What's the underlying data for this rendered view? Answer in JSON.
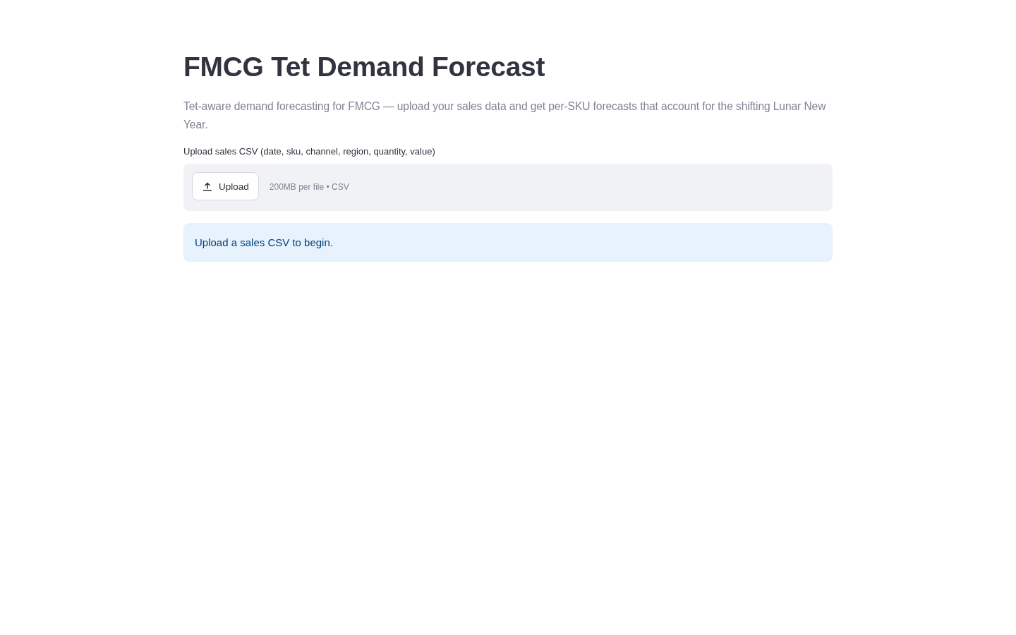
{
  "page": {
    "title": "FMCG Tet Demand Forecast",
    "subtitle": "Tet-aware demand forecasting for FMCG — upload your sales data and get per-SKU forecasts that account for the shifting Lunar New Year."
  },
  "file_uploader": {
    "label": "Upload sales CSV (date, sku, channel, region, quantity, value)",
    "button": "Upload",
    "hint": "200MB per file • CSV"
  },
  "alert": {
    "kind": "info",
    "text": "Upload a sales CSV to begin."
  }
}
